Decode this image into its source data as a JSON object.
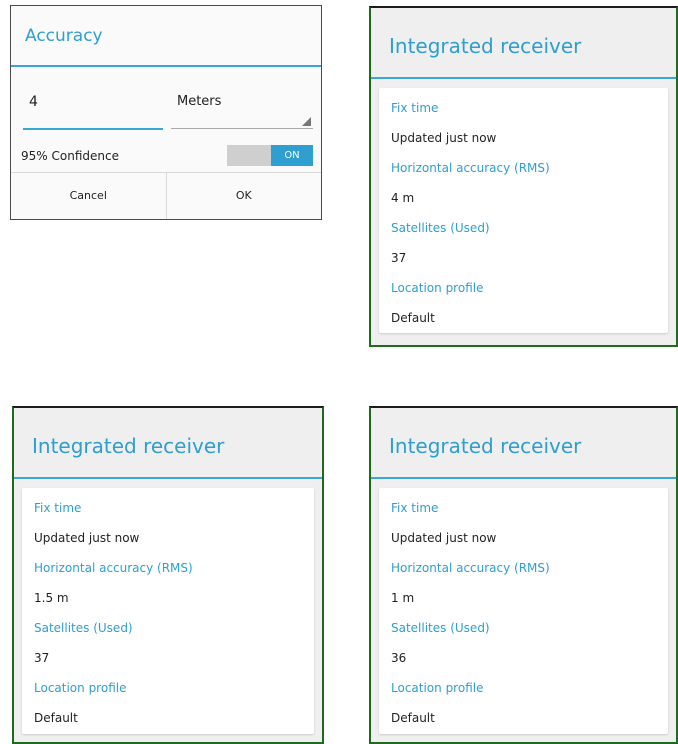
{
  "accuracy_dialog": {
    "title": "Accuracy",
    "value": "4",
    "unit": "Meters",
    "confidence_label": "95% Confidence",
    "toggle_state": "ON",
    "cancel_label": "Cancel",
    "ok_label": "OK"
  },
  "panels": [
    {
      "title": "Integrated receiver",
      "fix_time_label": "Fix time",
      "fix_time_value": "Updated just now",
      "accuracy_label": "Horizontal accuracy (RMS)",
      "accuracy_value": "4 m",
      "satellites_label": "Satellites (Used)",
      "satellites_value": "37",
      "profile_label": "Location profile",
      "profile_value": "Default"
    },
    {
      "title": "Integrated receiver",
      "fix_time_label": "Fix time",
      "fix_time_value": "Updated just now",
      "accuracy_label": "Horizontal accuracy (RMS)",
      "accuracy_value": "1.5 m",
      "satellites_label": "Satellites (Used)",
      "satellites_value": "37",
      "profile_label": "Location profile",
      "profile_value": "Default"
    },
    {
      "title": "Integrated receiver",
      "fix_time_label": "Fix time",
      "fix_time_value": "Updated just now",
      "accuracy_label": "Horizontal accuracy (RMS)",
      "accuracy_value": "1 m",
      "satellites_label": "Satellites (Used)",
      "satellites_value": "36",
      "profile_label": "Location profile",
      "profile_value": "Default"
    }
  ],
  "colors": {
    "accent": "#2e9fce",
    "frame": "#1e6b1e",
    "panel_bg": "#efefef"
  }
}
